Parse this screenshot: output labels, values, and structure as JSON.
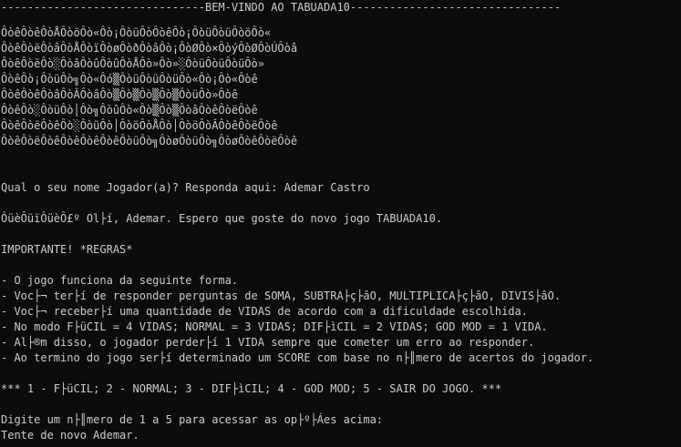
{
  "terminal": {
    "header": "-------------------------------BEM-VINDO AO TABUADA10--------------------------------",
    "banner": [
      "ÔòêÔòêÔòÅÔòöÔò«Ôò¡ÔòüÔòÔòêÔò¡ÔòüÔòüÔòöÔò«",
      "ÔòêÔòëÔòâÔòÅÔòïÔòøÔòðÔòâÔò¡ÔòØÔò×ÔòýÔòØÔòÚÔòâ",
      "ÔòêÔòëÔò░ÔòâÔòûÔòûÔòÅÔò»Ôò»░ÔòüÔòüÔòüÔò»",
      "ÔòêÔò¡ÔòüÔò╗Ôò«Ôó▒ÔòüÔòüÔòüÔò«Ôò¡Ôò«Ôòê",
      "ÔòêÔòêÔòâÔòÂÔòâÔò▒Ôò▒Ôò▒Ôò▒ÔòüÔò»Ôòê",
      "ÔòêÔò░ÔòüÔò│Ôò╗ÔòûÔò«Ôò▒Ôò▒ÔòâÔòêÔòëÔòê",
      "ÔòêÔòëÔòêÔò░ÔòüÔò│ÔòöÔòÅÔò│ÔòöÔòÂÔòêÔòëÔòê",
      "ÔòêÔòëÔòêÔòêÔòêÔòêÔòüÔò╗ÔòøÔòüÔò╗ÔòøÔòêÔòëÔòê"
    ],
    "prompt_name": "Qual o seu nome Jogador(a)? Responda aqui: Ademar Castro",
    "greeting": "ÔüèÔüïÔüèÔ£º Ol├í, Ademar. Espero que goste do novo jogo TABUADA10.",
    "important": "IMPORTANTE! *REGRAS*",
    "rules": [
      "- O jogo funciona da seguinte forma.",
      "- Voc├¬ ter├í de responder perguntas de SOMA, SUBTRA├ç├âO, MULTIPLICA├ç├âO, DIVIS├âO.",
      "- Voc├¬ receber├í uma quantidade de VIDAS de acordo com a dificuldade escolhida.",
      "- No modo F├üCIL = 4 VIDAS; NORMAL = 3 VIDAS; DIF├ìCIL = 2 VIDAS; GOD MOD = 1 VIDA.",
      "- Al├®m disso, o jogador perder├í 1 VIDA sempre que cometer um erro ao responder.",
      "- Ao termino do jogo ser├í determinado um SCORE com base no n├║mero de acertos do jogador."
    ],
    "menu": "*** 1 - F├üCIL; 2 - NORMAL; 3 - DIF├ìCIL; 4 - GOD MOD; 5 - SAIR DO JOGO. ***",
    "prompt_option": "Digite um n├║mero de 1 a 5 para acessar as op├º├Áes acima:",
    "retry": "Tente de novo Ademar."
  }
}
